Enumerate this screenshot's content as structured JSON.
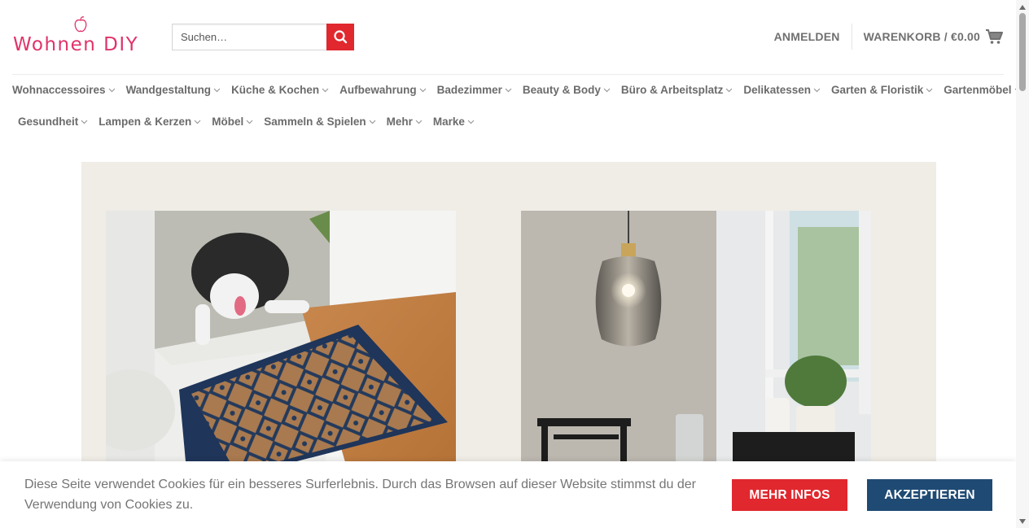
{
  "brand": {
    "name": "Wohnen DIY",
    "color": "#e0336a"
  },
  "search": {
    "placeholder": "Suchen…"
  },
  "header": {
    "login_label": "ANMELDEN",
    "cart_label": "WARENKORB / €0.00"
  },
  "nav": {
    "row1": [
      "Wohnaccessoires",
      "Wandgestaltung",
      "Küche & Kochen",
      "Aufbewahrung",
      "Badezimmer",
      "Beauty & Body",
      "Büro & Arbeitsplatz",
      "Delikatessen",
      "Garten & Floristik",
      "Gartenmöbel"
    ],
    "row2": [
      "Gesundheit",
      "Lampen & Kerzen",
      "Möbel",
      "Sammeln & Spielen",
      "Mehr",
      "Marke"
    ]
  },
  "hero": {
    "background": "#f0ede6",
    "images": [
      {
        "icon": "doormat-dog-image"
      },
      {
        "icon": "pendant-lamp-image"
      }
    ]
  },
  "cookie": {
    "text": "Diese Seite verwendet Cookies für ein besseres Surferlebnis. Durch das Browsen auf dieser Website stimmst du der Verwendung von Cookies zu.",
    "more_label": "MEHR INFOS",
    "accept_label": "AKZEPTIEREN"
  },
  "colors": {
    "accent_red": "#e0282e",
    "accent_blue": "#1f4a73",
    "nav_text": "#6b6b6b"
  }
}
